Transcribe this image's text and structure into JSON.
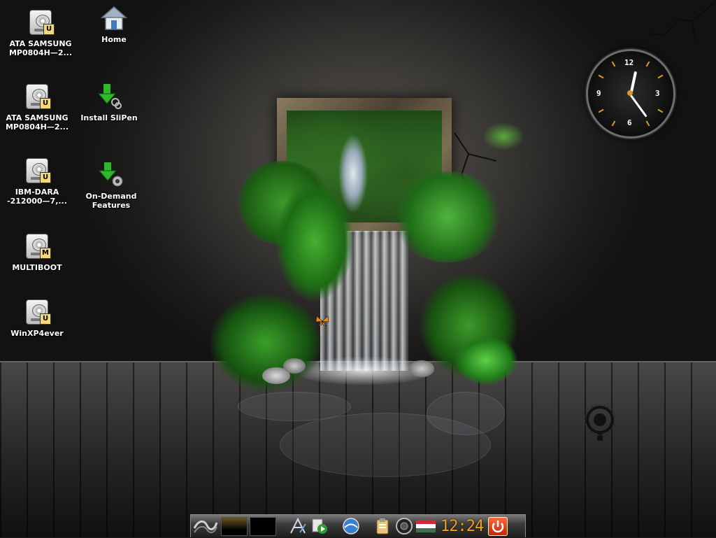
{
  "desktop_icons": [
    {
      "label": "ATA SAMSUNG MP0804H—2...",
      "type": "drive",
      "badge": "U"
    },
    {
      "label": "Home",
      "type": "home"
    },
    {
      "label": "ATA SAMSUNG MP0804H—2...",
      "type": "drive",
      "badge": "U"
    },
    {
      "label": "Install SliPen",
      "type": "install"
    },
    {
      "label": "IBM-DARA -212000—7,...",
      "type": "drive",
      "badge": "U"
    },
    {
      "label": "On-Demand Features",
      "type": "ondemand"
    },
    {
      "label": "MULTIBOOT",
      "type": "drive",
      "badge": "M"
    },
    {
      "label": "WinXP4ever",
      "type": "drive",
      "badge": "U"
    }
  ],
  "clock_widget": {
    "numerals": [
      "12",
      "3",
      "6",
      "9"
    ],
    "time": {
      "hour": 12,
      "minute": 24
    }
  },
  "taskbar": {
    "start_icon": "wave-logo-icon",
    "desktops": [
      "desktop-1",
      "desktop-2"
    ],
    "launchers": [
      "text-editor-icon",
      "media-player-icon",
      "browser-icon"
    ],
    "tray": [
      "clipboard-icon",
      "volume-icon",
      "keyboard-layout-flag-icon"
    ],
    "clock_text": "12:24",
    "power_icon": "power-icon"
  },
  "colors": {
    "clock_accent": "#d89a2c",
    "taskbar_clock": "#f0a21c",
    "power_button": "#e0401a",
    "badge": "#f3d77c"
  }
}
